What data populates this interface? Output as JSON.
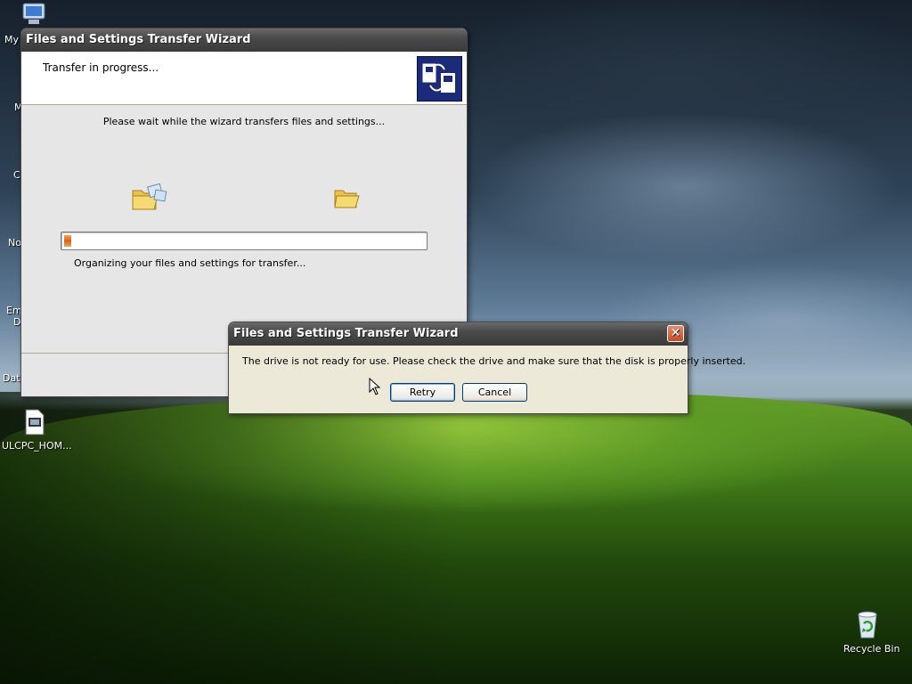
{
  "desktop": {
    "icons_left": [
      {
        "label": "My",
        "icon": "my-computer-icon"
      },
      {
        "label": "M",
        "icon": "my-documents-icon"
      },
      {
        "label": "C",
        "icon": "c-icon"
      },
      {
        "label": "No",
        "icon": "no-icon"
      },
      {
        "label": "Em",
        "icon": "em-icon"
      },
      {
        "label": "D",
        "icon": "d-icon"
      },
      {
        "label": "Dat",
        "icon": "dat-icon"
      }
    ],
    "file_icon_label": "ULCPC_HOM...",
    "recycle_bin_label": "Recycle Bin"
  },
  "wizard": {
    "title": "Files and Settings Transfer Wizard",
    "header_title": "Transfer in progress...",
    "wait_text": "Please wait while the wizard transfers files and settings...",
    "progress_percent": 2,
    "status_text": "Organizing your files and settings for transfer..."
  },
  "dialog": {
    "title": "Files and Settings Transfer Wizard",
    "message": "The drive is not ready for use. Please check the drive and make sure that the disk is properly inserted.",
    "retry_label": "Retry",
    "cancel_label": "Cancel",
    "close_glyph": "✕"
  }
}
